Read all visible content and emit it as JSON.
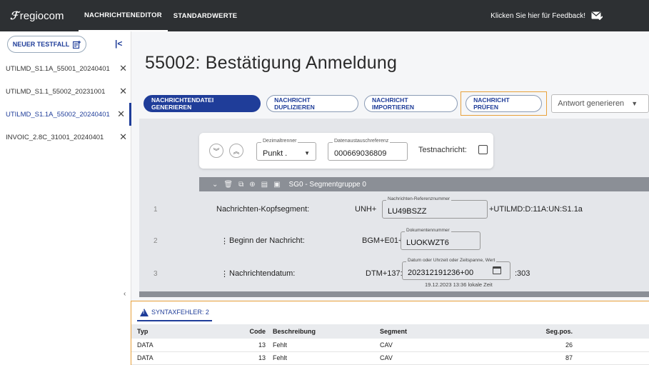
{
  "topbar": {
    "brand": "regiocom",
    "nav": [
      "NACHRICHTENEDITOR",
      "STANDARDWERTE"
    ],
    "feedback": "Klicken Sie hier für Feedback!"
  },
  "sidebar": {
    "new_testcase": "NEUER TESTFALL",
    "testcases": [
      {
        "label": "UTILMD_S1.1A_55001_20240401",
        "active": false
      },
      {
        "label": "UTILMD_S1.1_55002_20231001",
        "active": false
      },
      {
        "label": "UTILMD_S1.1A_55002_20240401",
        "active": true
      },
      {
        "label": "INVOIC_2.8C_31001_20240401",
        "active": false
      }
    ]
  },
  "main": {
    "title": "55002: Bestätigung Anmeldung",
    "toolbar": {
      "generate": "NACHRICHTENDATEI GENERIEREN",
      "duplicate": "NACHRICHT DUPLIZIEREN",
      "import": "NACHRICHT IMPORTIEREN",
      "check": "NACHRICHT PRÜFEN",
      "answer_select": "Antwort generieren"
    },
    "settings": {
      "decimal_label": "Dezimaltrenner",
      "decimal_value": "Punkt .",
      "exchange_ref_label": "Datenaustauschreferenz",
      "exchange_ref_value": "000669036809",
      "test_label": "Testnachricht:"
    },
    "segment_group": "SG0 - Segmentgruppe 0",
    "rows": [
      {
        "num": "1",
        "label": "Nachrichten-Kopfsegment:",
        "prefix": "UNH+",
        "field_label": "Nachrichten-Referenznummer",
        "field_value": "LU49BSZZ",
        "suffix": "+UTILMD:D:11A:UN:S1.1a",
        "hint": ""
      },
      {
        "num": "2",
        "label": "Beginn der Nachricht:",
        "prefix": "BGM+E01+",
        "field_label": "Dokumentennummer",
        "field_value": "LUOKWZT6",
        "suffix": "",
        "hint": ""
      },
      {
        "num": "3",
        "label": "Nachrichtendatum:",
        "prefix": "DTM+137:",
        "field_label": "Datum oder Uhrzeit oder Zeitspanne, Wert",
        "field_value": "202312191236+00",
        "suffix": ":303",
        "hint": "19.12.2023 13:36 lokale Zeit"
      }
    ]
  },
  "errors": {
    "tab": "SYNTAXFEHLER: 2",
    "columns": [
      "Typ",
      "Code",
      "Beschreibung",
      "Segment",
      "Seg.pos."
    ],
    "rows": [
      [
        "DATA",
        "13",
        "Fehlt",
        "CAV",
        "26"
      ],
      [
        "DATA",
        "13",
        "Fehlt",
        "CAV",
        "87"
      ]
    ]
  },
  "colors": {
    "topbar": "#2d3033",
    "primary": "#1f3d99",
    "highlight": "#e8a13b"
  }
}
